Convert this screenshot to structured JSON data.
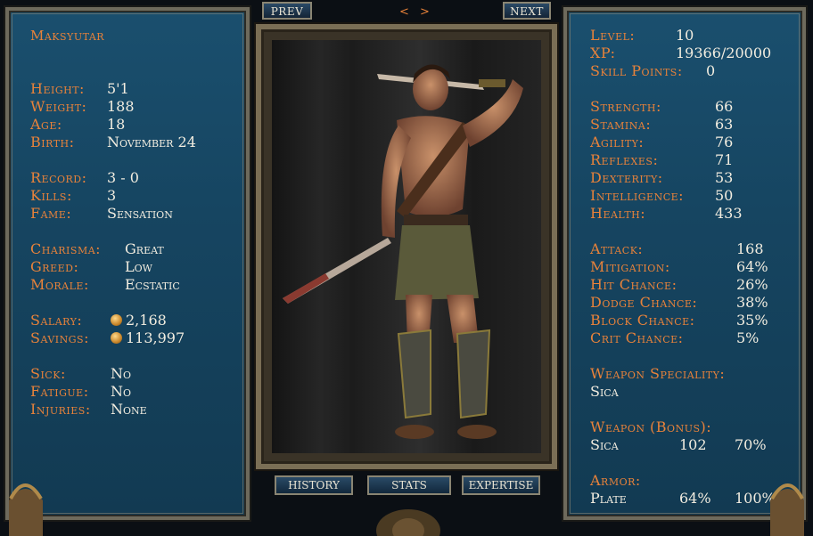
{
  "nav": {
    "prev": "PREV",
    "next": "NEXT",
    "arrows": "< >"
  },
  "tabs": {
    "history": "HISTORY",
    "stats": "STATS",
    "expertise": "EXPERTISE"
  },
  "gladiator": {
    "name": "Maksyutar",
    "height_label": "Height:",
    "height": "5'1",
    "weight_label": "Weight:",
    "weight": "188",
    "age_label": "Age:",
    "age": "18",
    "birth_label": "Birth:",
    "birth": "November 24",
    "record_label": "Record:",
    "record": "3 - 0",
    "kills_label": "Kills:",
    "kills": "3",
    "fame_label": "Fame:",
    "fame": "Sensation",
    "charisma_label": "Charisma:",
    "charisma": "Great",
    "greed_label": "Greed:",
    "greed": "Low",
    "morale_label": "Morale:",
    "morale": "Ecstatic",
    "salary_label": "Salary:",
    "salary": "2,168",
    "savings_label": "Savings:",
    "savings": "113,997",
    "sick_label": "Sick:",
    "sick": "No",
    "fatigue_label": "Fatigue:",
    "fatigue": "No",
    "injuries_label": "Injuries:",
    "injuries": "None"
  },
  "stats": {
    "level_label": "Level:",
    "level": "10",
    "xp_label": "XP:",
    "xp": "19366/20000",
    "skill_points_label": "Skill Points:",
    "skill_points": "0",
    "strength_label": "Strength:",
    "strength": "66",
    "stamina_label": "Stamina:",
    "stamina": "63",
    "agility_label": "Agility:",
    "agility": "76",
    "reflexes_label": "Reflexes:",
    "reflexes": "71",
    "dexterity_label": "Dexterity:",
    "dexterity": "53",
    "intelligence_label": "Intelligence:",
    "intelligence": "50",
    "health_label": "Health:",
    "health": "433",
    "attack_label": "Attack:",
    "attack": "168",
    "mitigation_label": "Mitigation:",
    "mitigation": "64%",
    "hit_label": "Hit Chance:",
    "hit": "26%",
    "dodge_label": "Dodge Chance:",
    "dodge": "38%",
    "block_label": "Block Chance:",
    "block": "35%",
    "crit_label": "Crit Chance:",
    "crit": "5%",
    "weapon_spec_label": "Weapon Speciality:",
    "weapon_spec": "Sica",
    "weapon_bonus_label": "Weapon (Bonus):",
    "weapon_bonus_name": "Sica",
    "weapon_bonus_a": "102",
    "weapon_bonus_b": "70%",
    "armor_label": "Armor:",
    "armor_name": "Plate",
    "armor_a": "64%",
    "armor_b": "100%"
  },
  "colors": {
    "label": "#e8823a",
    "value": "#f2ede0",
    "panel": "#164561"
  }
}
